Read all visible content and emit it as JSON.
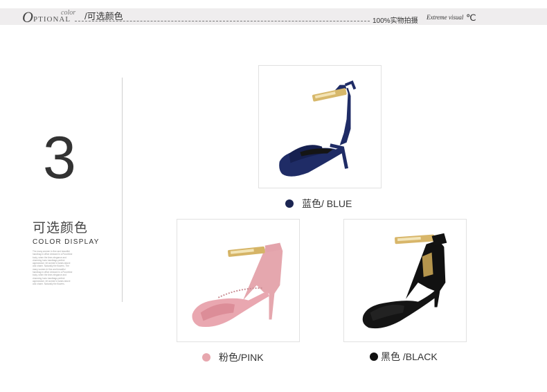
{
  "header": {
    "optional_big": "O",
    "optional_rest": "PTIONAL",
    "color_script": "color",
    "title": "/可选颜色",
    "real_shot": "100%实物拍摄",
    "script_text": "Extreme visual",
    "celsius": "℃"
  },
  "intro": {
    "number": "3",
    "cn_title": "可选颜色",
    "en_title": "COLOR DISPLAY",
    "fine_print": "The many women in fine and beautiful handbag in office dressed in a Punchline body, when the lines elegance and charming hues handbags perfect appearance, let women's hands above and charm. Naturally the flowers. The many women in fine and beautiful handbag in office dressed in a Punchline body, when the lines elegance and charming hues handbags perfect appearance, let women's hands above and charm. Naturally the flowers."
  },
  "products": [
    {
      "label": "蓝色/ BLUE",
      "color": "#1b2552",
      "icon": "blue-sandal"
    },
    {
      "label": "粉色/PINK",
      "color": "#e7a7ae",
      "icon": "pink-sandal"
    },
    {
      "label": "黑色 /BLACK",
      "color": "#111111",
      "icon": "black-sandal"
    }
  ]
}
